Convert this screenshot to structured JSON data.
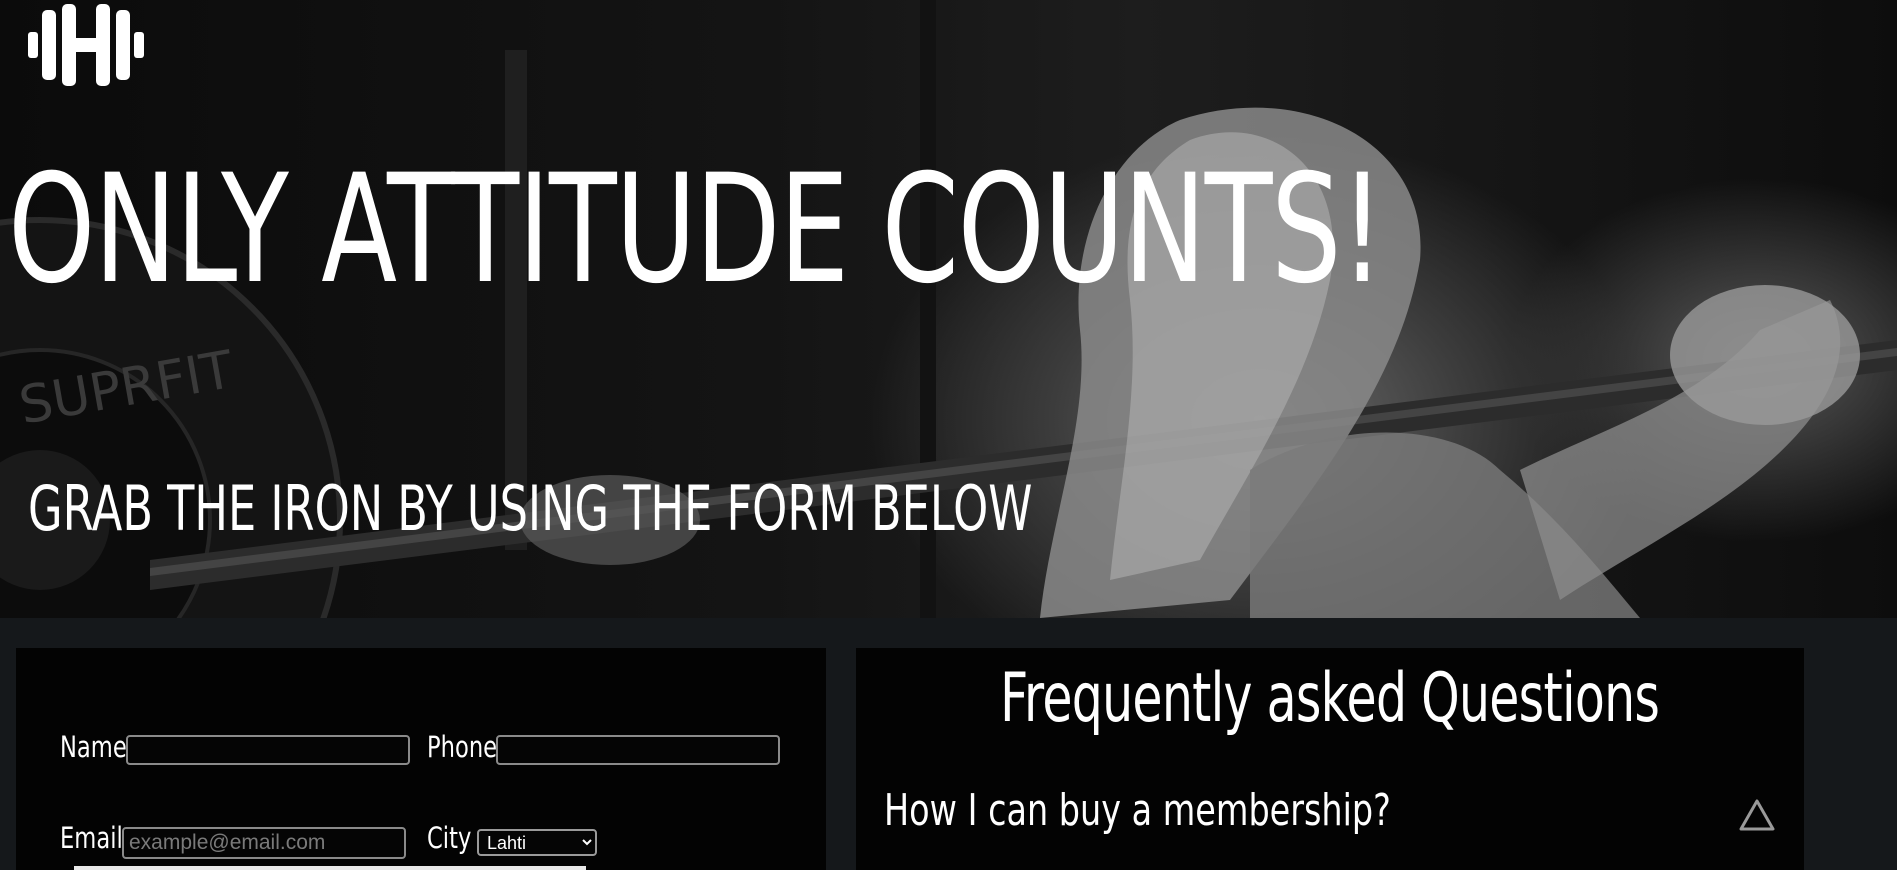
{
  "brand": {
    "logo_icon": "barbell-icon"
  },
  "hero": {
    "title": "ONLY ATTITUDE COUNTS!",
    "subtitle": "GRAB THE IRON BY USING THE FORM BELOW"
  },
  "form": {
    "name_label": "Name",
    "name_value": "",
    "phone_label": "Phone",
    "phone_value": "",
    "email_label": "Email",
    "email_placeholder": "example@email.com",
    "city_label": "City",
    "city_selected": "Lahti"
  },
  "faq": {
    "title": "Frequently asked Questions",
    "items": [
      {
        "question": "How I can buy a membership?",
        "toggle_icon": "triangle-up-icon"
      }
    ]
  },
  "colors": {
    "page_background": "#15181b",
    "panel_background": "#030303",
    "text": "#ffffff",
    "input_border": "#8a8a8a"
  }
}
